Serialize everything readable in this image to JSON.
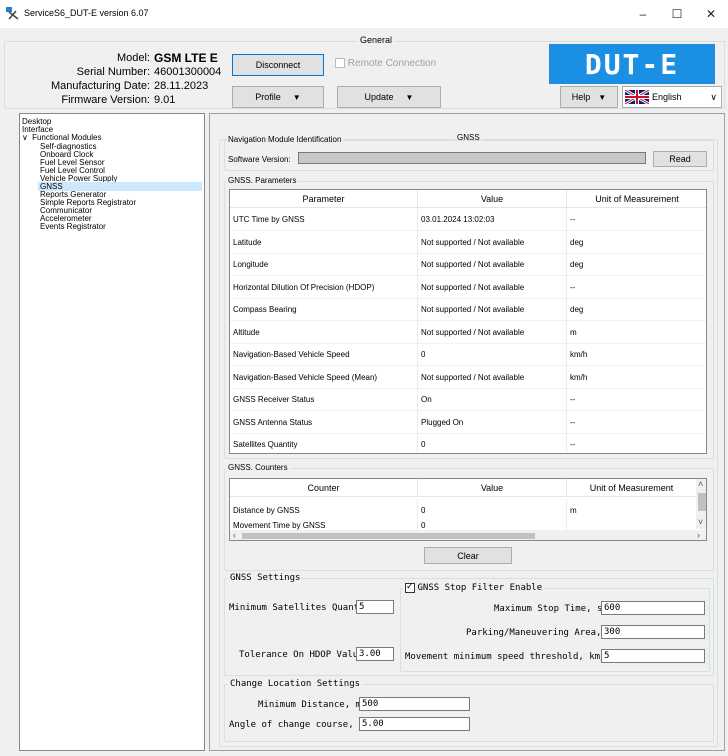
{
  "window": {
    "title": "ServiceS6_DUT-E version 6.07",
    "minimize": "–",
    "maximize": "☐",
    "close": "✕"
  },
  "header": {
    "group_title": "General",
    "model_label": "Model:",
    "model_value": "GSM LTE E",
    "serial_label": "Serial Number:",
    "serial_value": "46001300004",
    "mfg_label": "Manufacturing Date:",
    "mfg_value": "28.11.2023",
    "fw_label": "Firmware Version:",
    "fw_value": "9.01",
    "disconnect": "Disconnect",
    "remote_connection": "Remote Connection",
    "profile": "Profile",
    "update": "Update",
    "help": "Help",
    "language": "English",
    "logo_text": "DUT-E"
  },
  "tree": {
    "items": [
      {
        "label": "Desktop"
      },
      {
        "label": "Interface"
      },
      {
        "label": "Functional Modules",
        "expander": "∨"
      },
      {
        "label": "Self-diagnostics"
      },
      {
        "label": "Onboard Clock"
      },
      {
        "label": "Fuel Level Sensor"
      },
      {
        "label": "Fuel Level Control"
      },
      {
        "label": "Vehicle Power Supply"
      },
      {
        "label": "GNSS"
      },
      {
        "label": "Reports Generator"
      },
      {
        "label": "Simple Reports Registrator"
      },
      {
        "label": "Communicator"
      },
      {
        "label": "Accelerometer"
      },
      {
        "label": "Events Registrator"
      }
    ]
  },
  "gnss": {
    "title": "GNSS",
    "nav_id_title": "Navigation Module Identification",
    "software_version_label": "Software Version:",
    "software_version_value": "",
    "read": "Read",
    "params_title": "GNSS. Parameters",
    "params_headers": [
      "Parameter",
      "Value",
      "Unit of Measurement"
    ],
    "params_rows": [
      [
        "UTC Time by GNSS",
        "03.01.2024 13:02:03",
        "--"
      ],
      [
        "Latitude",
        "Not supported / Not available",
        "deg"
      ],
      [
        "Longitude",
        "Not supported / Not available",
        "deg"
      ],
      [
        "Horizontal Dilution Of Precision (HDOP)",
        "Not supported / Not available",
        "--"
      ],
      [
        "Compass Bearing",
        "Not supported / Not available",
        "deg"
      ],
      [
        "Altitude",
        "Not supported / Not available",
        "m"
      ],
      [
        "Navigation-Based Vehicle Speed",
        "0",
        "km/h"
      ],
      [
        "Navigation-Based Vehicle Speed (Mean)",
        "Not supported / Not available",
        "km/h"
      ],
      [
        "GNSS Receiver Status",
        "On",
        "--"
      ],
      [
        "GNSS Antenna Status",
        "Plugged On",
        "--"
      ],
      [
        "Satellites Quantity",
        "0",
        "--"
      ]
    ],
    "counters_title": "GNSS. Counters",
    "counters_headers": [
      "Counter",
      "Value",
      "Unit of Measurement"
    ],
    "counters_rows": [
      [
        "Distance by GNSS",
        "0",
        "m"
      ],
      [
        "Movement Time by GNSS",
        "0",
        ""
      ]
    ],
    "clear": "Clear",
    "settings_title": "GNSS Settings",
    "min_sat_label": "Minimum Satellites Quantity:",
    "min_sat_value": "5",
    "hdop_label": "Tolerance On HDOP Value:",
    "hdop_value": "3.00",
    "stop_filter_label": "GNSS Stop Filter Enable",
    "stop_filter_checked": true,
    "max_stop_label": "Maximum Stop Time, s:",
    "max_stop_value": "600",
    "parking_label": "Parking/Maneuvering Area, m:",
    "parking_value": "300",
    "move_speed_label": "Movement minimum speed threshold, km/h:",
    "move_speed_value": "5",
    "change_loc_title": "Change Location Settings",
    "min_dist_label": "Minimum Distance, m:",
    "min_dist_value": "500",
    "angle_label": "Angle of change course, deg:",
    "angle_value": "5.00"
  }
}
